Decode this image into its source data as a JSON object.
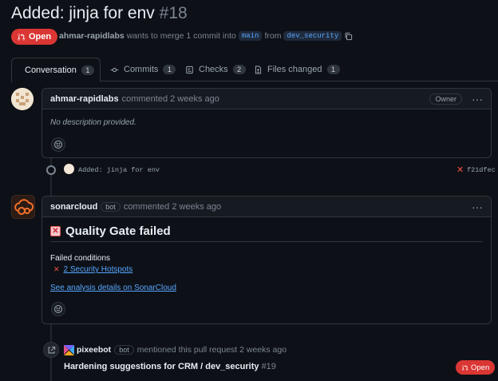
{
  "pr": {
    "title": "Added: jinja for env",
    "number": "#18",
    "state": "Open",
    "author": "ahmar-rapidlabs",
    "merge_text": "wants to merge 1 commit into",
    "base_branch": "main",
    "from_text": "from",
    "head_branch": "dev_security"
  },
  "tabs": [
    {
      "label": "Conversation",
      "count": "1"
    },
    {
      "label": "Commits",
      "count": "1"
    },
    {
      "label": "Checks",
      "count": "2"
    },
    {
      "label": "Files changed",
      "count": "1"
    }
  ],
  "comment1": {
    "author": "ahmar-rapidlabs",
    "action": "commented 2 weeks ago",
    "role": "Owner",
    "body": "No description provided."
  },
  "commit": {
    "message": "Added: jinja for env",
    "sha": "f21dfec"
  },
  "comment2": {
    "author": "sonarcloud",
    "bot_label": "bot",
    "action": "commented 2 weeks ago",
    "heading": "Quality Gate failed",
    "failed_label": "Failed conditions",
    "condition": "2 Security Hotspots",
    "details_link": "See analysis details on SonarCloud"
  },
  "mention": {
    "author": "pixeebot",
    "bot_label": "bot",
    "action": "mentioned this pull request 2 weeks ago",
    "ref_title": "Hardening suggestions for CRM / dev_security",
    "ref_number": "#19",
    "ref_state": "Open"
  },
  "colors": {
    "background": "#0d1117",
    "open_red": "#da3633",
    "link_blue": "#58a6ff"
  }
}
